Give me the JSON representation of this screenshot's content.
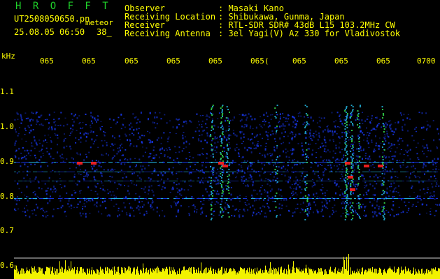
{
  "header": {
    "app_name": "H R O F F T",
    "file_name": "UT2508050650.pn",
    "meteor_word": "meteor",
    "date_time": "25.08.05 06:50",
    "count": "38_"
  },
  "meta": [
    {
      "label": "Observer",
      "value": ": Masaki Kano"
    },
    {
      "label": "Receiving Location",
      "value": ": Shibukawa, Gunma, Japan"
    },
    {
      "label": "Receiver",
      "value": ": RTL-SDR SDR# 43dB L15 103.2MHz CW"
    },
    {
      "label": "Receiving Antenna",
      "value": ": 3el Yagi(V) Az 330 for Vladivostok"
    }
  ],
  "axis": {
    "unit": "kHz",
    "time_ticks": [
      "065",
      "065",
      "065",
      "065",
      "065",
      "065(",
      "065",
      "065",
      "065",
      "0700"
    ],
    "freq_ticks": [
      "1.1",
      "1.0",
      "0.9",
      "0.8",
      "0.7",
      "0.6"
    ]
  },
  "colors": {
    "background": "#000000",
    "text_yellow": "#ffff00",
    "title_green": "#1fd12a",
    "noise_blue": "#1a3cff",
    "echo_cyan": "#28d0ff",
    "echo_green": "#3cff5a",
    "echo_red": "#ff2020",
    "level_bar": "#ffff00"
  }
}
